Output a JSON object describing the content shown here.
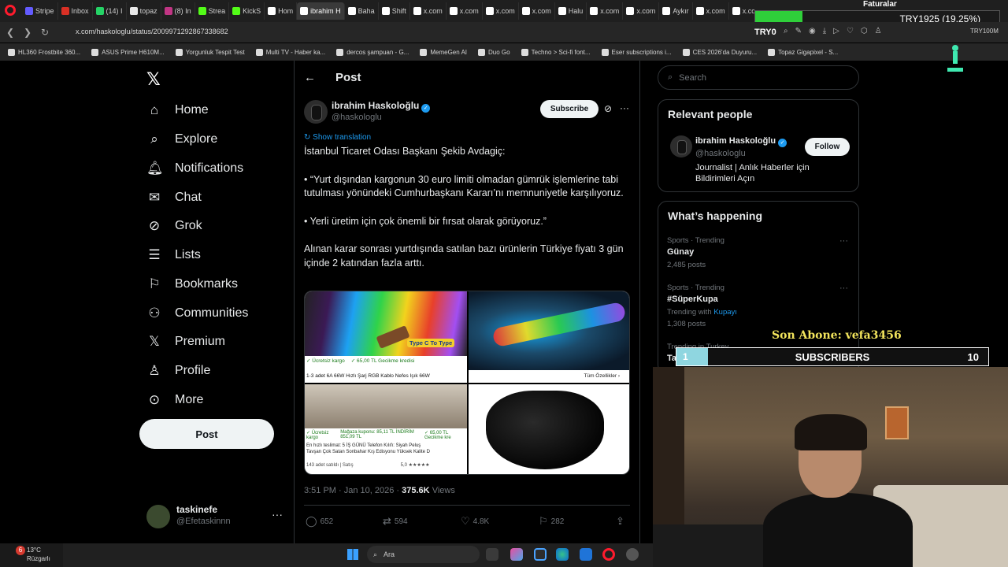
{
  "browser": {
    "tabs": [
      {
        "label": "Stripe",
        "color": "#635bff"
      },
      {
        "label": "Inbox",
        "color": "#d93025"
      },
      {
        "label": "(14) I",
        "color": "#25d366"
      },
      {
        "label": "topaz",
        "color": "#e8e8e8"
      },
      {
        "label": "(8) In",
        "color": "#c13584"
      },
      {
        "label": "Strea",
        "color": "#53fc18"
      },
      {
        "label": "KickS",
        "color": "#53fc18"
      },
      {
        "label": "Hom",
        "color": "#ffffff"
      },
      {
        "label": "ibrahim H",
        "color": "#ffffff",
        "active": true
      },
      {
        "label": "Baha",
        "color": "#ffffff"
      },
      {
        "label": "Shift",
        "color": "#ffffff"
      },
      {
        "label": "x.com",
        "color": "#ffffff"
      },
      {
        "label": "x.com",
        "color": "#ffffff"
      },
      {
        "label": "x.com",
        "color": "#ffffff"
      },
      {
        "label": "x.com",
        "color": "#ffffff"
      },
      {
        "label": "Halu",
        "color": "#ffffff"
      },
      {
        "label": "x.com",
        "color": "#ffffff"
      },
      {
        "label": "x.com",
        "color": "#ffffff"
      },
      {
        "label": "Aykır",
        "color": "#ffffff"
      },
      {
        "label": "x.com",
        "color": "#ffffff"
      },
      {
        "label": "x.com",
        "color": "#ffffff"
      }
    ],
    "url": "x.com/haskologlu/status/2009971292867338682",
    "bookmarks": [
      "HL360 Frostbite 360...",
      "ASUS Prime H610M...",
      "Yorgunluk Tespit Test",
      "Multi TV - Haber ka...",
      "dercos şampuan - G...",
      "MemeGen AI",
      "Duo Go",
      "Techno > Sci-fi font...",
      "Eser subscriptions i...",
      "CES 2026'da Duyuru...",
      "Topaz Gigapixel - S..."
    ]
  },
  "overlay": {
    "faturalar": "Faturalar",
    "try_progress_text": "TRY1925 (19.25%)",
    "try_progress": 0.1925,
    "try0": "TRY0",
    "try_tag": "TRY100M",
    "son_abone": "Son Abone: vefa3456",
    "subs_current": "1",
    "subs_label": "SUBSCRIBERS",
    "subs_goal": "10",
    "subs_progress": 0.1
  },
  "nav": {
    "home": "Home",
    "explore": "Explore",
    "notifications": "Notifications",
    "chat": "Chat",
    "grok": "Grok",
    "lists": "Lists",
    "bookmarks": "Bookmarks",
    "communities": "Communities",
    "premium": "Premium",
    "profile": "Profile",
    "more": "More",
    "post_button": "Post"
  },
  "account": {
    "name": "taskinefe",
    "handle": "@Efetaskinnn"
  },
  "post": {
    "header": "Post",
    "author_name": "ibrahim Haskoloğlu",
    "author_handle": "@haskologlu",
    "subscribe": "Subscribe",
    "show_translation": "Show translation",
    "paragraphs": [
      "İstanbul Ticaret Odası Başkanı Şekib Avdagiç:",
      "• “Yurt dışından kargonun 30 euro limiti olmadan gümrük işlemlerine tabi tutulması yönündeki Cumhurbaşkanı Kararı’nı memnuniyetle karşılıyoruz.",
      "• Yerli üretim için çok önemli bir fırsat olarak görüyoruz.”",
      "Alınan karar sonrası yurtdışında satılan bazı ürünlerin Türkiye fiyatı 3 gün içinde 2 katından fazla arttı."
    ],
    "media": {
      "m1_tag": "Type C To Type",
      "m1_badge1": "✓ Ücretsiz kargo",
      "m1_badge2": "✓ 65,00 TL Gecikme kredisi",
      "m1_caption": "1-3 adet 6A 66W Hızlı Şarj RGB Kablo Nefes Işık 66W",
      "m2_caption": "Tüm Özellikler  ›",
      "m3_badge1": "✓ Ücretsiz kargo",
      "m3_badge2": "Mağaza kuponu: 85,11 TL İNDİRİM 851,09 TL",
      "m3_badge3": "✓ 65,00 TL Gecikme kre",
      "m3_line1": "En hızlı teslimat: 5 İŞ GÜNÜ  Telefon Kılıfı: Siyah Peluş",
      "m3_line2": "Tavşan Çok Satan Sonbahar Kış Edisyonu Yüksek Kalite D",
      "m3_line3": "143 adet satıldı | Satış",
      "m3_rating": "5,0 ★★★★★"
    },
    "time": "3:51 PM · Jan 10, 2026 ·",
    "views_count": "375.6K",
    "views_label": "Views",
    "replies": "652",
    "reposts": "594",
    "likes": "4.8K",
    "bookmarks": "282"
  },
  "right": {
    "search_placeholder": "Search",
    "relevant_title": "Relevant people",
    "rel_name": "ibrahim Haskoloğlu",
    "rel_handle": "@haskologlu",
    "rel_bio": "Journalist | Anlık Haberler için Bildirimleri Açın",
    "follow": "Follow",
    "happening_title": "What’s happening",
    "trends": [
      {
        "meta": "Sports · Trending",
        "name": "Günay",
        "posts": "2,485 posts"
      },
      {
        "meta": "Sports · Trending",
        "name": "#SüperKupa",
        "with_prefix": "Trending with",
        "with_link": "Kupayı",
        "posts": "1,308 posts"
      },
      {
        "meta": "Trending in Turkey",
        "name": "Ta"
      }
    ]
  },
  "taskbar": {
    "badge": "6",
    "temp": "13°C",
    "condition": "Rüzgarlı",
    "search_placeholder": "Ara"
  }
}
